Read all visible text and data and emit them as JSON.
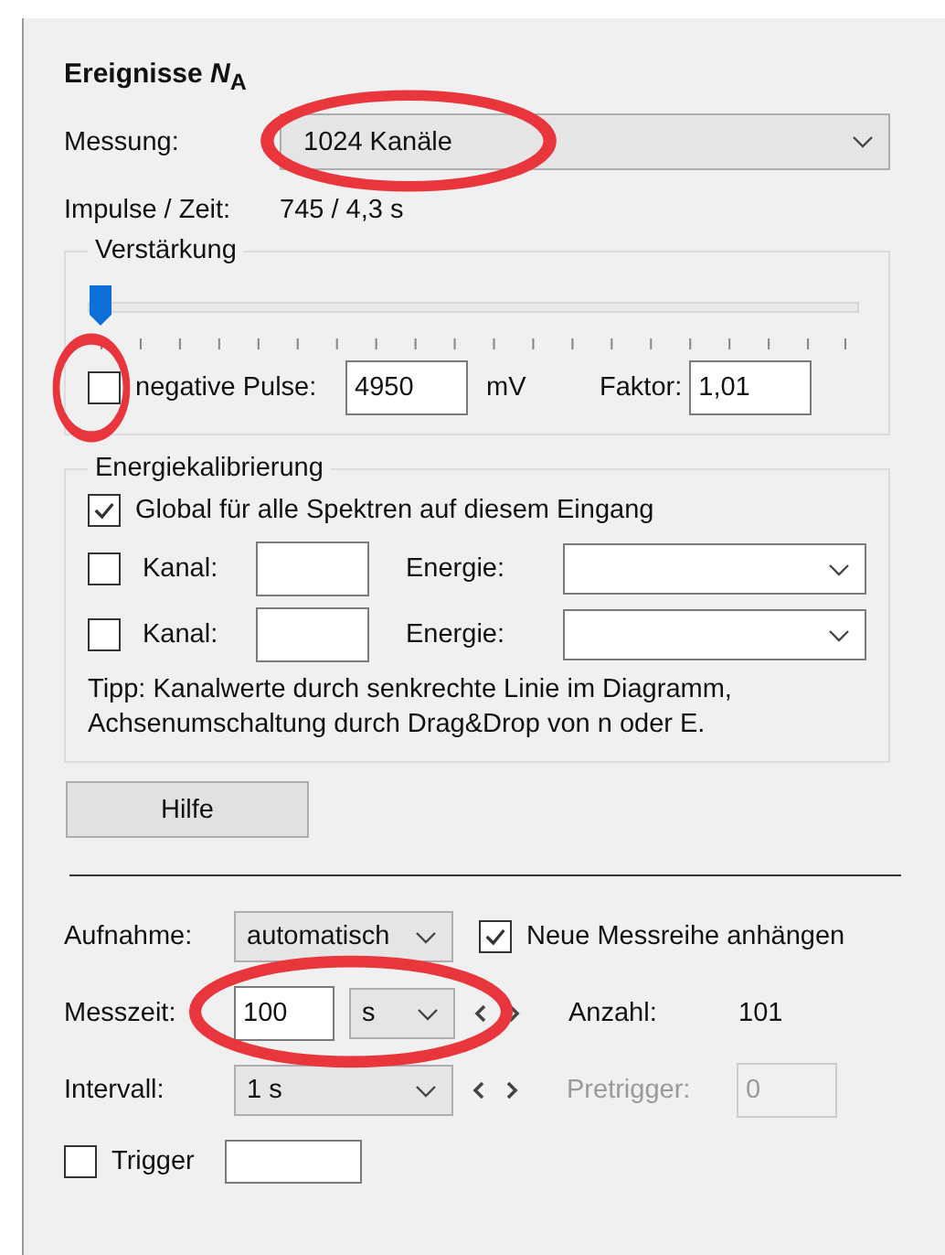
{
  "title": "Ereignisse *N*$_{A}$",
  "measurement": {
    "label": "Messung:",
    "value": "1024 Kanäle",
    "highlighted": true
  },
  "impulses": {
    "label": "Impulse / Zeit:",
    "value": "745 / 4,3 s"
  },
  "gain": {
    "title": "Verstärkung",
    "level": 0,
    "negative": {
      "label": "negative Pulse:",
      "checked": false,
      "highlighted": true
    },
    "voltage": "4950",
    "unit": "mV",
    "factor_label": "Faktor:",
    "factor": "1,01"
  },
  "calibration": {
    "title": "Energiekalibrierung",
    "global": {
      "label": "Global für alle Spektren auf diesem Eingang",
      "checked": true
    },
    "points": [
      {
        "checked": false,
        "channel_label": "Kanal:",
        "energy_label": "Energie:"
      },
      {
        "checked": false,
        "channel_label": "Kanal:",
        "energy_label": "Energie:"
      }
    ],
    "tip": "Tipp: Kanalwerte durch senkrechte Linie im Diagramm,\nAchsenumschaltung durch Drag&Drop von n oder E."
  },
  "help_button": "Hilfe",
  "recording": {
    "label": "Aufnahme:",
    "mode": "automatisch",
    "append": {
      "label": "Neue Messreihe anhängen",
      "checked": true
    }
  },
  "measure_time": {
    "label": "Messzeit:",
    "value": "100",
    "unit": "s",
    "highlighted": true,
    "count_label": "Anzahl:",
    "count": "101"
  },
  "interval": {
    "label": "Intervall:",
    "value": "1 s",
    "pretrigger": {
      "label": "Pretrigger:",
      "value": "0",
      "disabled": true
    }
  },
  "trigger": {
    "label": "Trigger",
    "checked": false
  }
}
